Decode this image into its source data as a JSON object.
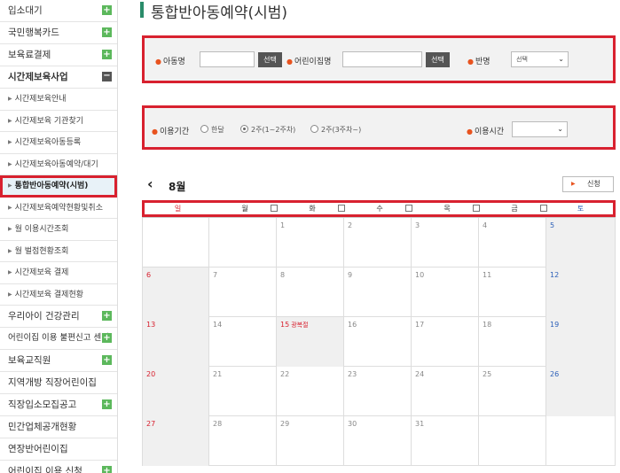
{
  "sidebar": {
    "items": [
      {
        "label": "입소대기",
        "icon": "plus"
      },
      {
        "label": "국민행복카드",
        "icon": "plus"
      },
      {
        "label": "보육료결제",
        "icon": "plus"
      },
      {
        "label": "시간제보육사업",
        "icon": "minus"
      }
    ],
    "sub_items": [
      {
        "label": "시간제보육안내"
      },
      {
        "label": "시간제보육 기관찾기"
      },
      {
        "label": "시간제보육아동등록"
      },
      {
        "label": "시간제보육아동예약/대기"
      },
      {
        "label": "통합반아동예약(시범)",
        "active": true
      },
      {
        "label": "시간제보육예약현황및취소"
      },
      {
        "label": "월 이용시간조회"
      },
      {
        "label": "월 벌점현황조회"
      },
      {
        "label": "시간제보육 결제"
      },
      {
        "label": "시간제보육 결제현황"
      }
    ],
    "bottom_items": [
      {
        "label": "우리아이 건강관리",
        "icon": "plus"
      },
      {
        "label": "어린이집 이용 불편신고 센터",
        "icon": "plus"
      },
      {
        "label": "보육교직원",
        "icon": "plus"
      },
      {
        "label": "지역개방 직장어린이집",
        "icon": ""
      },
      {
        "label": "직장입소모집공고",
        "icon": "plus"
      },
      {
        "label": "민간업체공개현황",
        "icon": ""
      },
      {
        "label": "연장반어린이집",
        "icon": ""
      },
      {
        "label": "어린이집 이용 신청",
        "icon": "plus"
      }
    ]
  },
  "page": {
    "title": "통합반아동예약(시범)"
  },
  "search": {
    "child_label": "아동명",
    "child_value": "",
    "child_btn": "선택",
    "center_label": "어린이집명",
    "center_value": "",
    "center_btn": "선택",
    "class_label": "반명",
    "class_value": "선택",
    "period_label": "이용기간",
    "period_options": [
      "한달",
      "2주(1~2주차)",
      "2주(3주차~)"
    ],
    "period_selected": 1,
    "time_label": "이용시간",
    "time_value": ""
  },
  "calendar": {
    "month_label": "8월",
    "prev_symbol": "‹",
    "apply_label": "신청",
    "apply_icon": "triangle-right",
    "weekdays": [
      "일",
      "월",
      "화",
      "수",
      "목",
      "금",
      "토"
    ],
    "weeks": [
      [
        "",
        "",
        "1",
        "2",
        "3",
        "4",
        "5"
      ],
      [
        "6",
        "7",
        "8",
        "9",
        "10",
        "11",
        "12"
      ],
      [
        "13",
        "14",
        "15",
        "16",
        "17",
        "18",
        "19"
      ],
      [
        "20",
        "21",
        "22",
        "23",
        "24",
        "25",
        "26"
      ],
      [
        "27",
        "28",
        "29",
        "30",
        "31",
        "",
        ""
      ]
    ],
    "holiday_note": "광복절"
  },
  "colors": {
    "accent_green": "#2a8c6a",
    "plus_green": "#5cb85c",
    "highlight_red": "#d8212f",
    "sunday": "#d8212f",
    "saturday": "#2b5fb8"
  }
}
